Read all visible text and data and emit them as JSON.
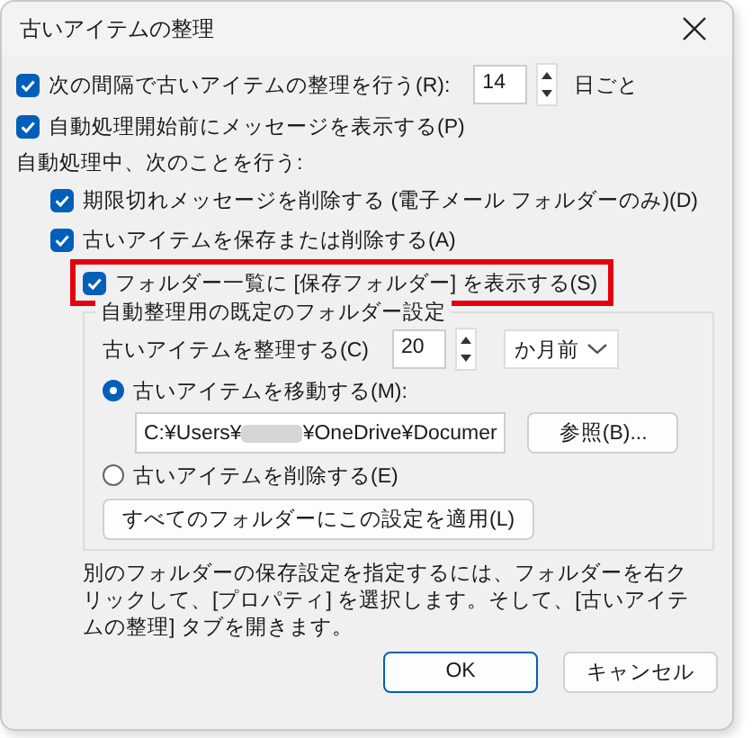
{
  "window": {
    "title": "古いアイテムの整理"
  },
  "autoarchive": {
    "label": "次の間隔で古いアイテムの整理を行う(R):",
    "checked": true,
    "days": "14",
    "unit": "日ごと"
  },
  "prompt": {
    "label": "自動処理開始前にメッセージを表示する(P)",
    "checked": true
  },
  "during_label": "自動処理中、次のことを行う:",
  "during_options": [
    {
      "label": "期限切れメッセージを削除する (電子メール フォルダーのみ)(D)",
      "checked": true,
      "highlighted": false
    },
    {
      "label": "古いアイテムを保存または削除する(A)",
      "checked": true,
      "highlighted": false,
      "children": [
        {
          "label": "フォルダー一覧に [保存フォルダー] を表示する(S)",
          "checked": true,
          "highlighted": true
        }
      ]
    }
  ],
  "defaults": {
    "legend": "自動整理用の既定のフォルダー設定",
    "age_label": "古いアイテムを整理する(C)",
    "age_value": "20",
    "age_unit": "か月前",
    "actions": [
      {
        "label": "古いアイテムを移動する(M):",
        "selected": true
      },
      {
        "label": "古いアイテムを削除する(E)",
        "selected": false
      }
    ],
    "path_start": "C:¥Users¥",
    "path_end": "¥OneDrive¥Documer",
    "browse": "参照(B)...",
    "apply_all": "すべてのフォルダーにこの設定を適用(L)"
  },
  "note": "別のフォルダーの保存設定を指定するには、フォルダーを右クリックして、[プロパティ] を選択します。そして、[古いアイテムの整理] タブを開きます。",
  "buttons": [
    {
      "label": "OK",
      "default": true
    },
    {
      "label": "キャンセル",
      "default": false
    }
  ]
}
